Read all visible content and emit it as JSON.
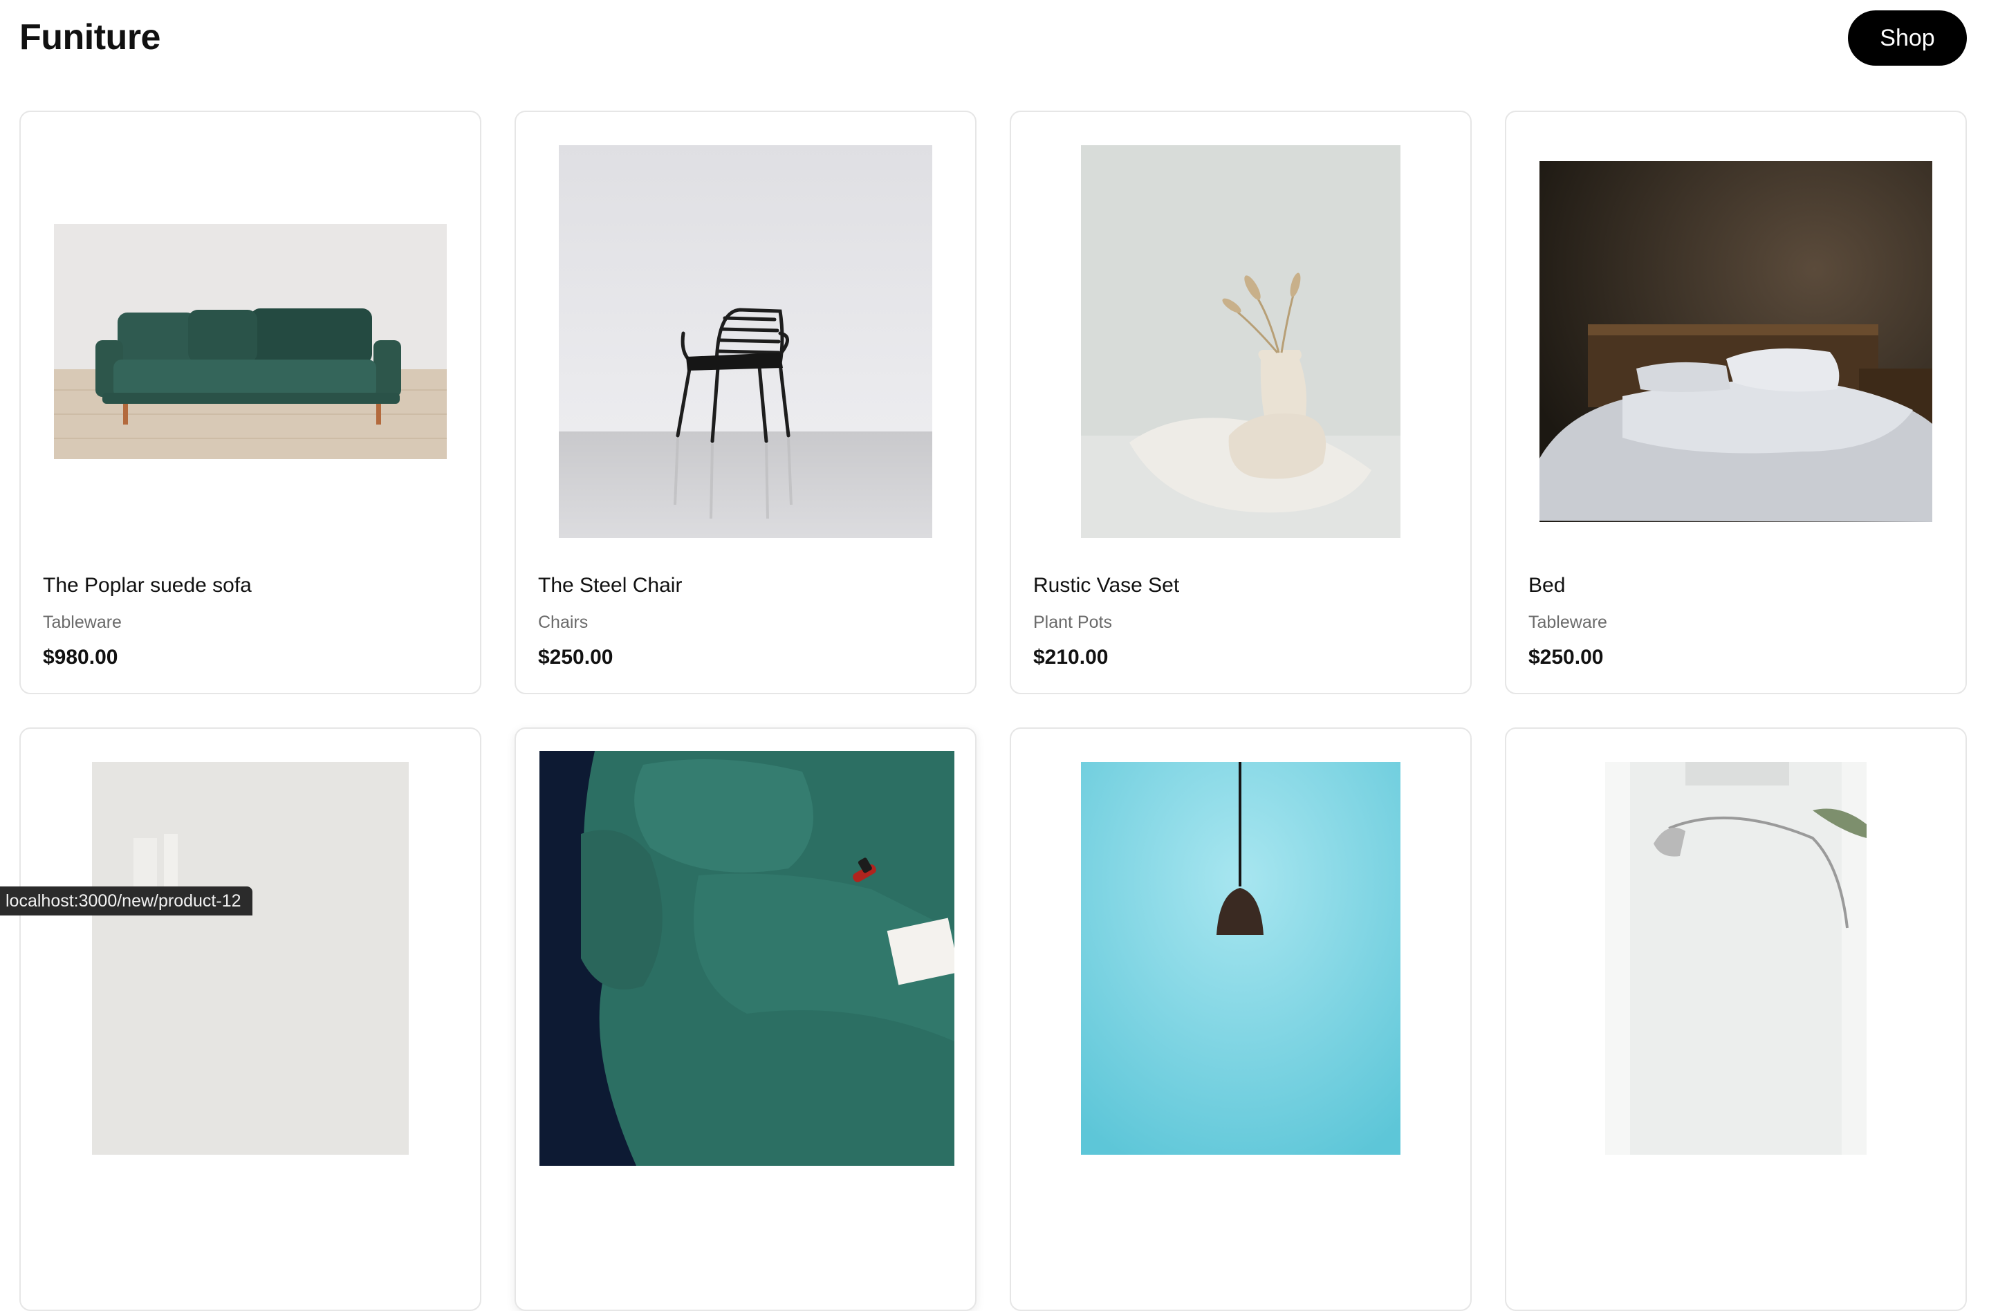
{
  "header": {
    "brand": "Funiture",
    "shop_label": "Shop"
  },
  "products": [
    {
      "title": "The Poplar suede sofa",
      "category": "Tableware",
      "price": "$980.00",
      "image": "green-sofa-photo"
    },
    {
      "title": "The Steel Chair",
      "category": "Chairs",
      "price": "$250.00",
      "image": "steel-chair-photo"
    },
    {
      "title": "Rustic Vase Set",
      "category": "Plant Pots",
      "price": "$210.00",
      "image": "vase-photo"
    },
    {
      "title": "Bed",
      "category": "Tableware",
      "price": "$250.00",
      "image": "bed-photo"
    },
    {
      "image": "white-room-photo"
    },
    {
      "image": "green-couch-closeup-photo"
    },
    {
      "image": "pendant-lamp-photo"
    },
    {
      "image": "arc-lamp-photo"
    }
  ],
  "status_bar": {
    "url": "localhost:3000/new/product-12"
  }
}
